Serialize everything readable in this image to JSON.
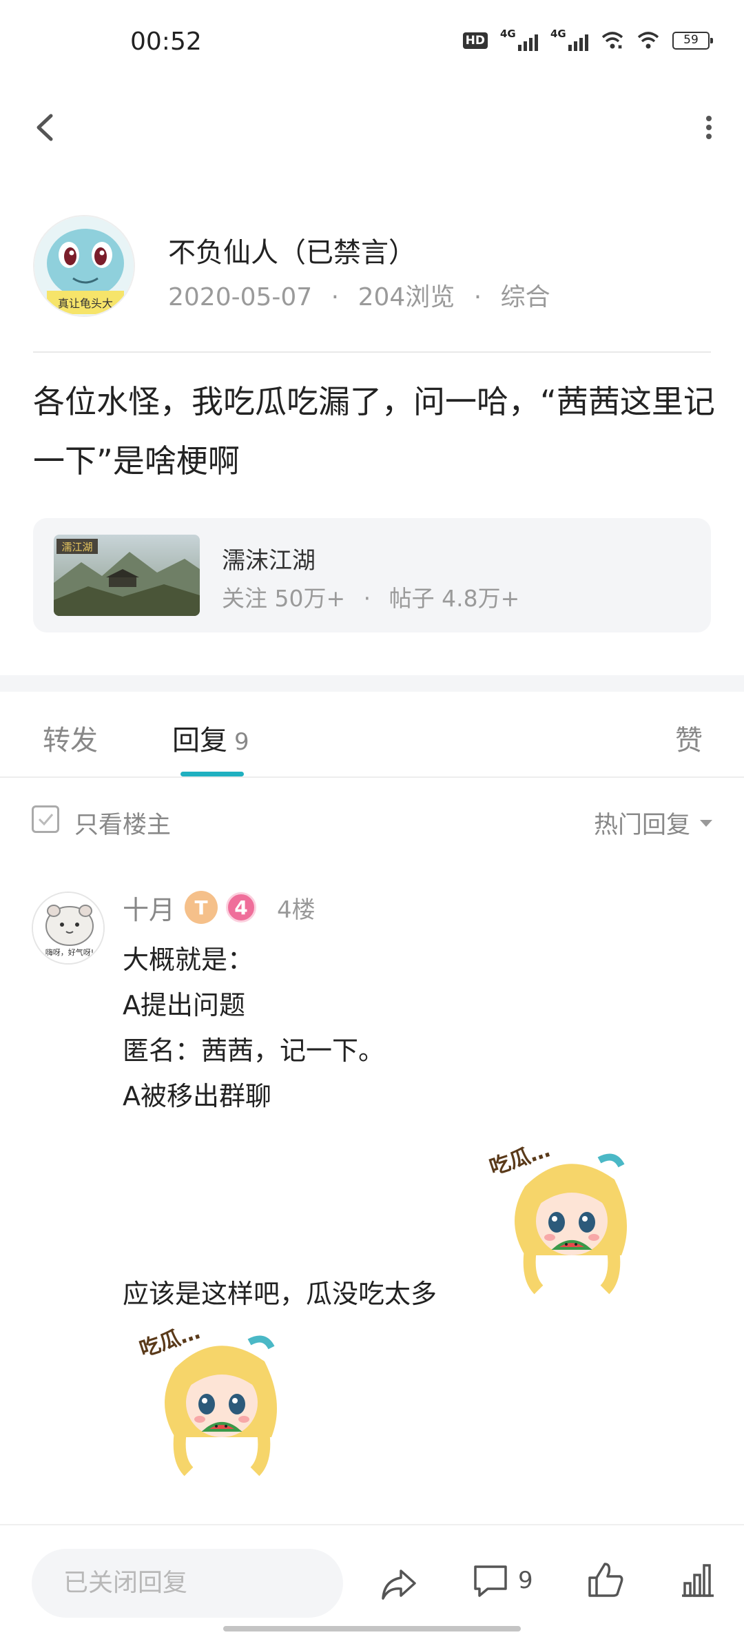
{
  "status_bar": {
    "time": "00:52",
    "hd_label": "HD",
    "network_1": "4G",
    "network_2": "4G",
    "battery": "59"
  },
  "post": {
    "author_name": "不负仙人（已禁言）",
    "date": "2020-05-07",
    "views": "204浏览",
    "category": "综合",
    "meta_sep": "·",
    "avatar_caption": "真让龟头大",
    "title": "各位水怪，我吃瓜吃漏了，问一哈，“茜茜这里记一下”是啥梗啊"
  },
  "forum": {
    "name": "濡沫江湖",
    "followers": "关注 50万+",
    "posts": "帖子 4.8万+",
    "sep": "·",
    "thumb_text": "濡江湖"
  },
  "tabs": {
    "forward": "转发",
    "reply": "回复",
    "reply_count": "9",
    "like": "赞"
  },
  "filter": {
    "only_op": "只看楼主",
    "sort": "热门回复"
  },
  "reply": {
    "user": "十月",
    "badge_t": "T",
    "badge_level": "4",
    "floor": "4楼",
    "avatar_caption": "嗨呀，好气呀!",
    "lines": [
      "大概就是：",
      "A提出问题",
      "匿名：茜茜，记一下。",
      "A被移出群聊"
    ],
    "tail": "应该是这样吧，瓜没吃太多",
    "sticker_text": "吃瓜…"
  },
  "bottom_bar": {
    "input_placeholder": "已关闭回复",
    "comment_count": "9"
  },
  "colors": {
    "accent": "#20b0c0",
    "text_primary": "#222222",
    "text_secondary": "#9a9a9a",
    "card_bg": "#f4f5f7"
  }
}
